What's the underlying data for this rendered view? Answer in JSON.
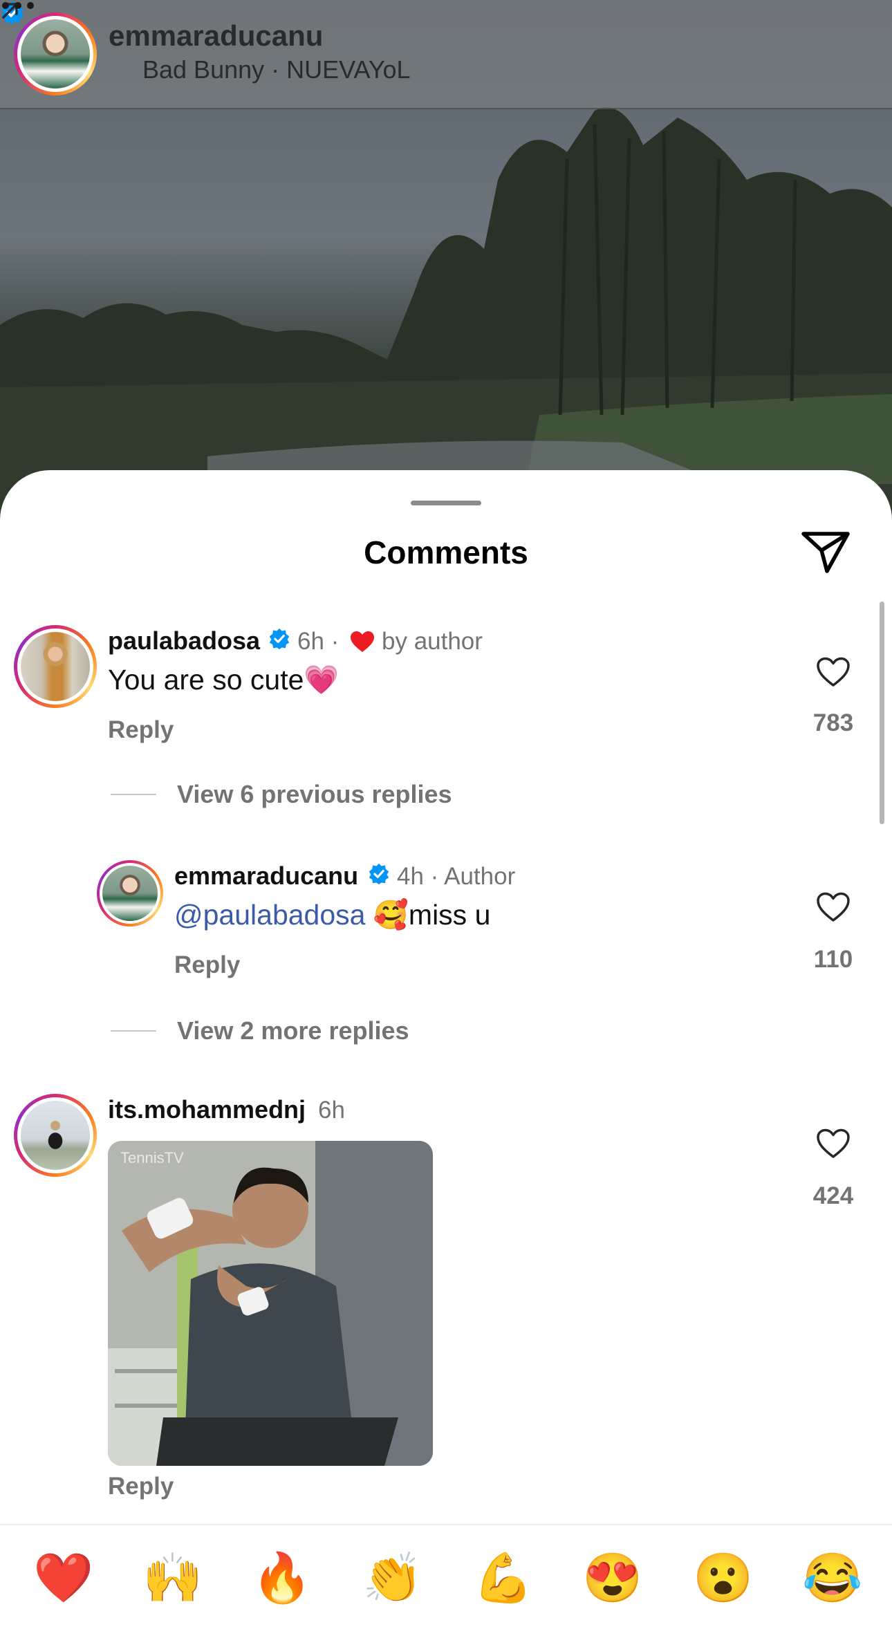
{
  "post": {
    "username": "emmaraducanu",
    "music": "Bad Bunny · NUEVAYoL"
  },
  "sheet": {
    "title": "Comments"
  },
  "comments": [
    {
      "username": "paulabadosa",
      "time": "6h ·",
      "liked_by_author": "by author",
      "text": "You are so cute",
      "text_emoji": "💗",
      "reply": "Reply",
      "likes": "783",
      "thread_link": "View 6 previous replies"
    },
    {
      "username": "emmaraducanu",
      "time": "4h · Author",
      "mention": "@paulabadosa",
      "text_emoji": "🥰",
      "text": "miss u",
      "reply": "Reply",
      "likes": "110",
      "thread_link": "View 2 more replies"
    },
    {
      "username": "its.mohammednj",
      "time": "6h",
      "gif_watermark": "TennisTV",
      "reply": "Reply",
      "likes": "424"
    }
  ],
  "emoji_bar": [
    "❤️",
    "🙌",
    "🔥",
    "👏",
    "💪",
    "😍",
    "😮",
    "😂"
  ],
  "colors": {
    "verified": "#0095f6",
    "heart": "#ed1c24",
    "mention": "#3b5ba9",
    "secondary_text": "#737373"
  }
}
